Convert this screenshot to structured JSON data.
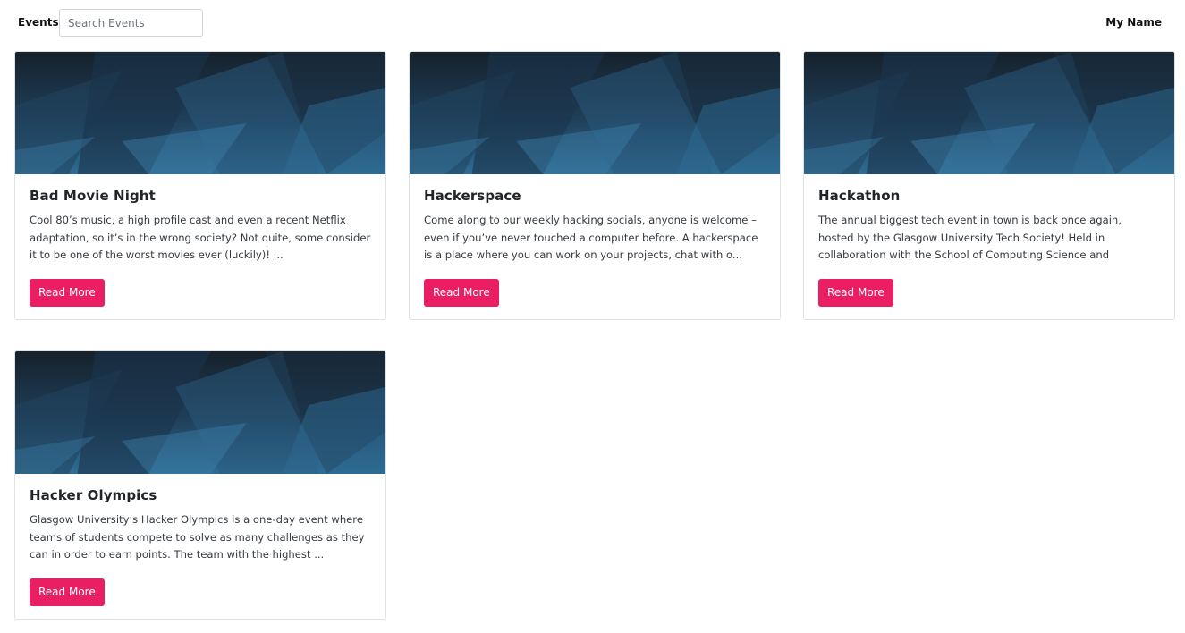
{
  "navbar": {
    "brand": "Events",
    "search_placeholder": "Search Events",
    "search_value": "",
    "user_name": "My Name"
  },
  "colors": {
    "button_bg": "#e91e63",
    "image_bg_dark": "#15202b",
    "image_bg_light": "#2f6c94"
  },
  "events": [
    {
      "title": "Bad Movie Night",
      "description": "Cool 80’s music, a high profile cast and even a recent Netflix adaptation, so it’s in the wrong society? Not quite, some consider it to be one of the worst movies ever (luckily)! ...",
      "button_label": "Read More"
    },
    {
      "title": "Hackerspace",
      "description": "Come along to our weekly hacking socials, anyone is welcome – even if you’ve never touched a computer before. A hackerspace is a place where you can work on your projects, chat with o...",
      "button_label": "Read More"
    },
    {
      "title": "Hackathon",
      "description": "The annual biggest tech event in town is back once again, hosted by the Glasgow University Tech Society! Held in collaboration with the School of Computing Science and influential...",
      "button_label": "Read More"
    },
    {
      "title": "Hacker Olympics",
      "description": "Glasgow University’s Hacker Olympics is a one-day event where teams of students compete to solve as many challenges as they can in order to earn points. The team with the highest ...",
      "button_label": "Read More"
    }
  ]
}
